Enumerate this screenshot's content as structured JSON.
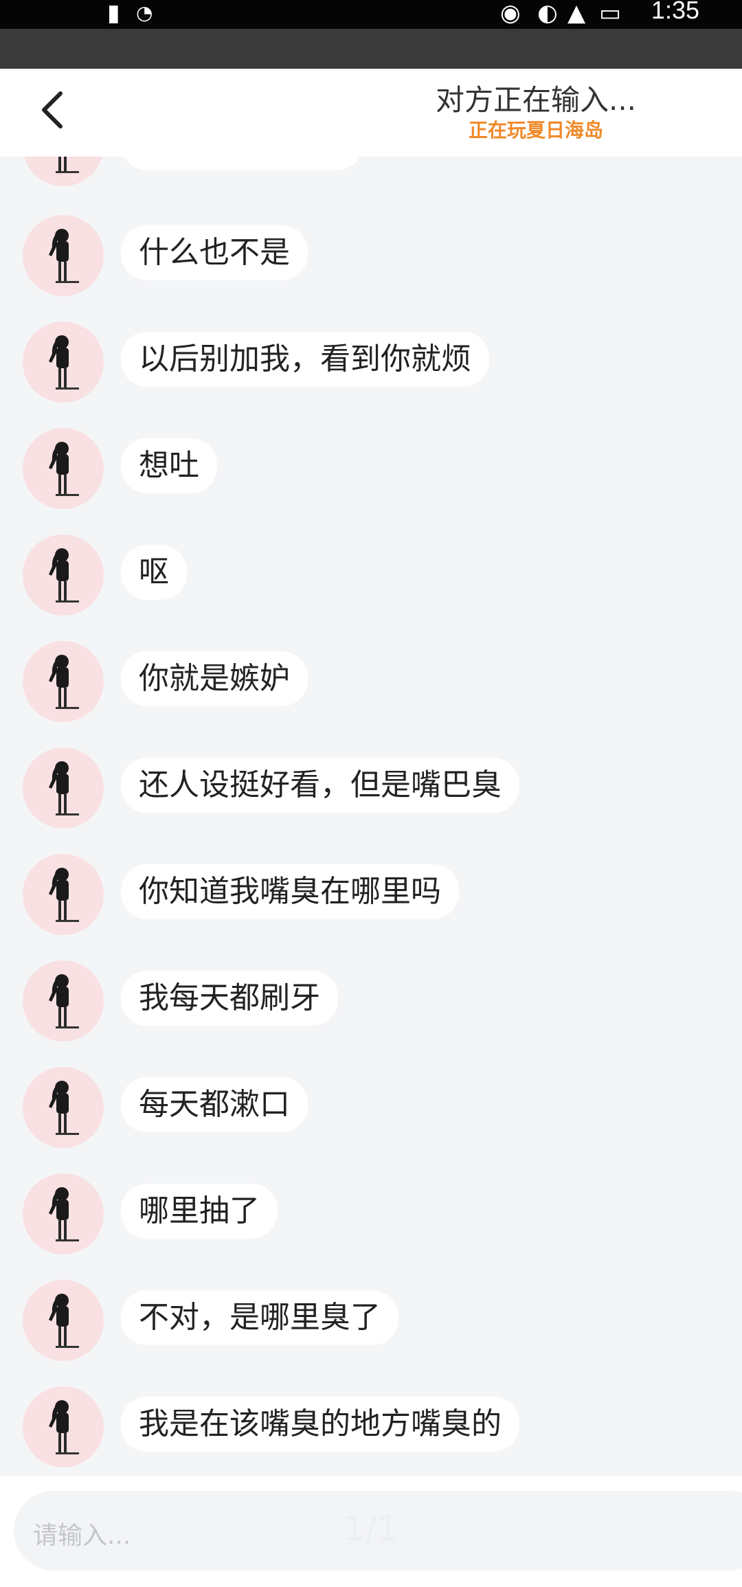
{
  "status_bar": {
    "time": "1:35"
  },
  "header": {
    "title": "对方正在输入...",
    "subtitle": "正在玩夏日海岛"
  },
  "messages": [
    {
      "text": ""
    },
    {
      "text": "什么也不是"
    },
    {
      "text": "以后别加我，看到你就烦"
    },
    {
      "text": "想吐"
    },
    {
      "text": "呕"
    },
    {
      "text": "你就是嫉妒"
    },
    {
      "text": "还人设挺好看，但是嘴巴臭"
    },
    {
      "text": "你知道我嘴臭在哪里吗"
    },
    {
      "text": "我每天都刷牙"
    },
    {
      "text": "每天都漱口"
    },
    {
      "text": "哪里抽了"
    },
    {
      "text": "不对，是哪里臭了"
    },
    {
      "text": "我是在该嘴臭的地方嘴臭的"
    }
  ],
  "input": {
    "placeholder": "请输入...",
    "counter": "1/1"
  },
  "colors": {
    "accent": "#f08a2a",
    "background": "#f4f5f7",
    "bubble": "#ffffff"
  }
}
